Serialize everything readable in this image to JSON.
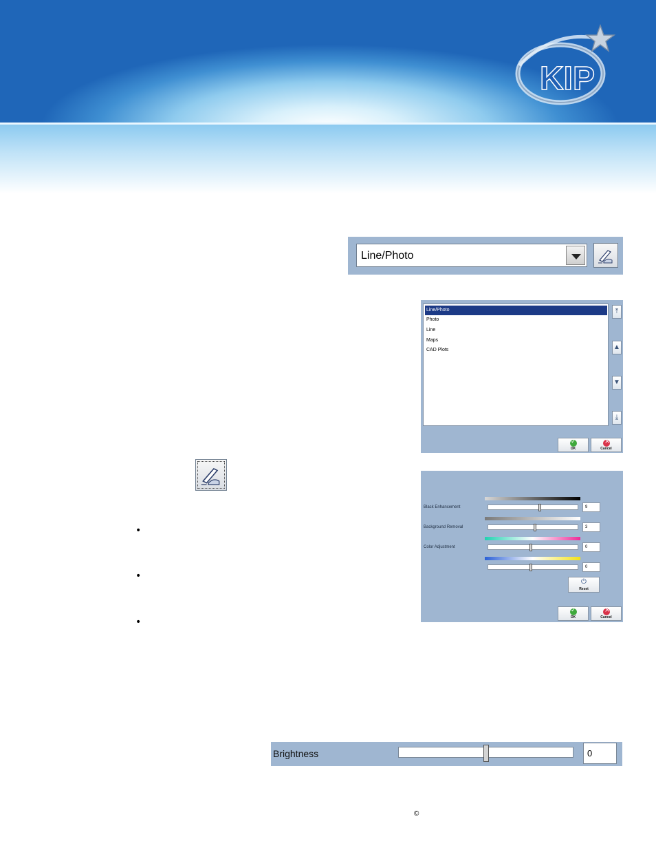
{
  "brand": {
    "logo_text": "KIP"
  },
  "image_mode": {
    "selected_value": "Line/Photo"
  },
  "mode_list": {
    "items": [
      "Line/Photo",
      "Photo",
      "Line",
      "Maps",
      "CAD Plots"
    ],
    "selected_index": 0,
    "ok_label": "OK",
    "cancel_label": "Cancel"
  },
  "adjustments": {
    "rows": [
      {
        "label": "Black Enhancement",
        "value": "9"
      },
      {
        "label": "Background Removal",
        "value": "3"
      },
      {
        "label": "Color Adjustment",
        "value": "0"
      },
      {
        "label": "",
        "value": "0"
      }
    ],
    "slider_fractions": [
      0.58,
      0.52,
      0.48,
      0.48
    ],
    "reset_label": "Reset",
    "ok_label": "OK",
    "cancel_label": "Cancel"
  },
  "bullets": [
    "•",
    "•",
    "•"
  ],
  "brightness": {
    "label": "Brightness",
    "value": "0",
    "slider_fraction": 0.5
  },
  "footer": {
    "copyright": "©"
  },
  "colors": {
    "panel": "#9fb6d1",
    "selection": "#1c3a86",
    "ok": "#3fa93c",
    "cancel": "#d9334a"
  }
}
